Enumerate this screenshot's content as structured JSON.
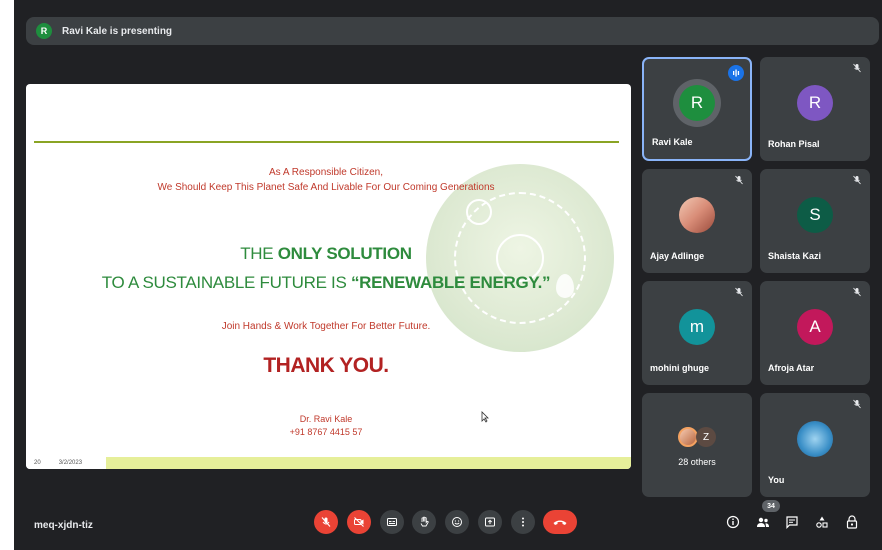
{
  "banner": {
    "avatar_letter": "R",
    "text": "Ravi Kale is presenting"
  },
  "slide": {
    "line1": "As A Responsible Citizen,",
    "line2": "We Should Keep This Planet Safe And Livable For Our Coming Generations",
    "headline1_pre": "THE ",
    "headline1_bold": "ONLY SOLUTION",
    "headline2_pre": "TO A SUSTAINABLE FUTURE IS ",
    "headline2_bold": "“RENEWABLE ENERGY.”",
    "join": "Join Hands & Work Together For Better Future.",
    "thanks": "THANK YOU.",
    "author": "Dr. Ravi Kale",
    "phone": "+91 8767 4415 57",
    "footer_page": "20",
    "footer_date": "3/2/2023"
  },
  "participants": [
    {
      "name": "Ravi Kale",
      "letter": "R",
      "color": "#1e8e3e",
      "speaking": true
    },
    {
      "name": "Rohan Pisal",
      "letter": "R",
      "color": "#7e57c2",
      "muted": true
    },
    {
      "name": "Ajay Adlinge",
      "letter": "",
      "photo": true,
      "muted": true
    },
    {
      "name": "Shaista Kazi",
      "letter": "S",
      "color": "#0d5c46",
      "muted": true
    },
    {
      "name": "mohini ghuge",
      "letter": "m",
      "color": "#12939a",
      "muted": true
    },
    {
      "name": "Afroja Atar",
      "letter": "A",
      "color": "#c2185b",
      "muted": true
    },
    {
      "name": "28 others",
      "others_letter": "Z"
    },
    {
      "name": "You",
      "photo": true,
      "muted": true
    }
  ],
  "meeting": {
    "code": "meq-xjdn-tiz",
    "participant_count": "34"
  },
  "colors": {
    "background": "#202124",
    "tile": "#3c4043",
    "danger": "#ea4335",
    "accent": "#8ab4f8"
  }
}
